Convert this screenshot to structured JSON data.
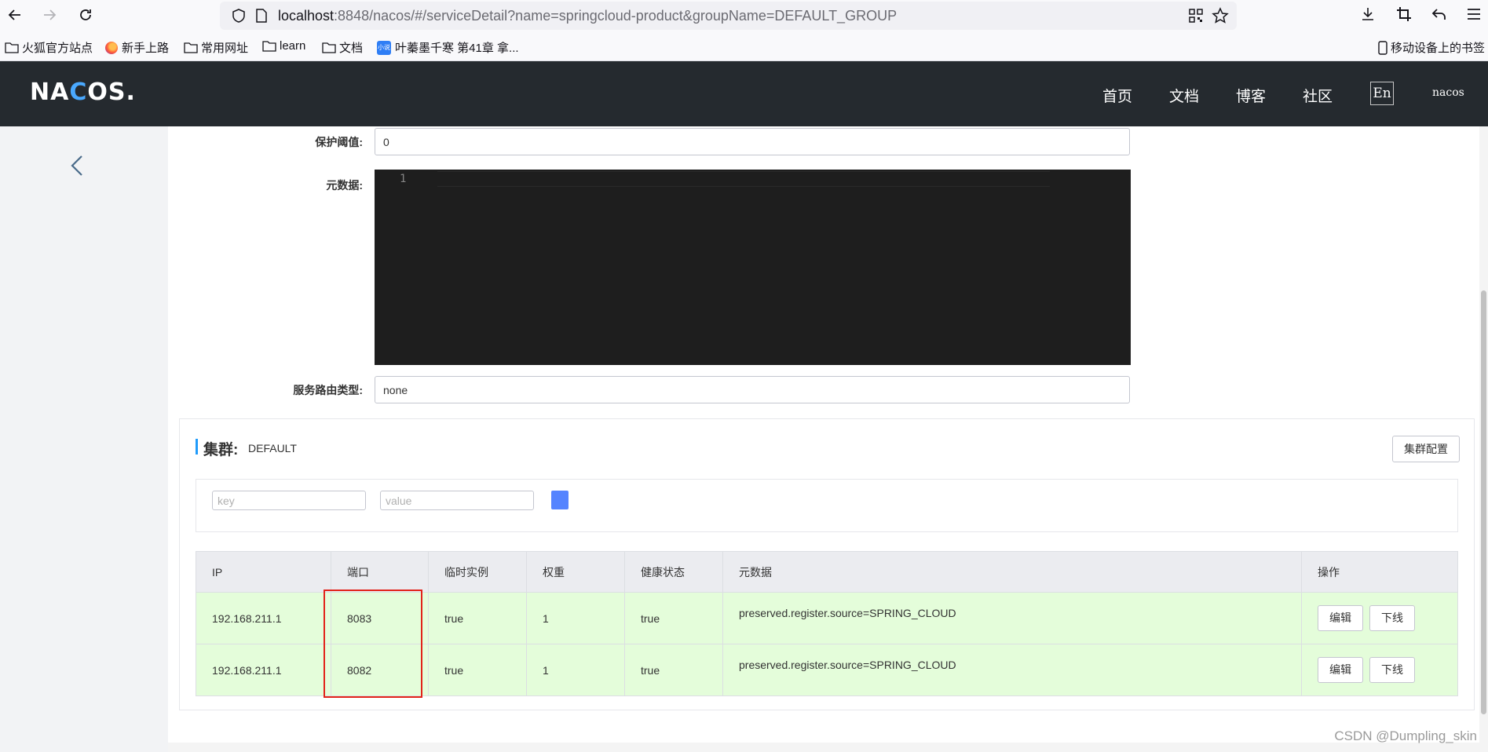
{
  "browser": {
    "url_host": "localhost",
    "url_rest": ":8848/nacos/#/serviceDetail?name=springcloud-product&groupName=DEFAULT_GROUP",
    "bookmarks": [
      "火狐官方站点",
      "新手上路",
      "常用网址",
      "learn",
      "文档",
      "叶蓁墨千寒 第41章 拿..."
    ],
    "mobile_bookmarks": "移动设备上的书签",
    "xs_icon_text": "小说"
  },
  "header": {
    "logo_pre": "NA",
    "logo_o": "C",
    "logo_post": "OS.",
    "nav": [
      "首页",
      "文档",
      "博客",
      "社区"
    ],
    "lang": "En",
    "user": "nacos"
  },
  "form": {
    "protect_threshold_label": "保护阈值:",
    "protect_threshold_value": "0",
    "metadata_label": "元数据:",
    "editor_line": "1",
    "selector_type_label": "服务路由类型:",
    "selector_type_value": "none"
  },
  "cluster": {
    "title": "集群:",
    "name": "DEFAULT",
    "config_button": "集群配置",
    "filter_key_placeholder": "key",
    "filter_value_placeholder": "value",
    "columns": [
      "IP",
      "端口",
      "临时实例",
      "权重",
      "健康状态",
      "元数据",
      "操作"
    ],
    "rows": [
      {
        "ip": "192.168.211.1",
        "port": "8083",
        "ephemeral": "true",
        "weight": "1",
        "healthy": "true",
        "metadata": "preserved.register.source=SPRING_CLOUD"
      },
      {
        "ip": "192.168.211.1",
        "port": "8082",
        "ephemeral": "true",
        "weight": "1",
        "healthy": "true",
        "metadata": "preserved.register.source=SPRING_CLOUD"
      }
    ],
    "edit_label": "编辑",
    "offline_label": "下线"
  },
  "watermark": "CSDN @Dumpling_skin",
  "colors": {
    "header_bg": "#252a2f",
    "row_bg": "#e4fdda",
    "highlight": "#e2231a",
    "accent": "#209bfa"
  }
}
